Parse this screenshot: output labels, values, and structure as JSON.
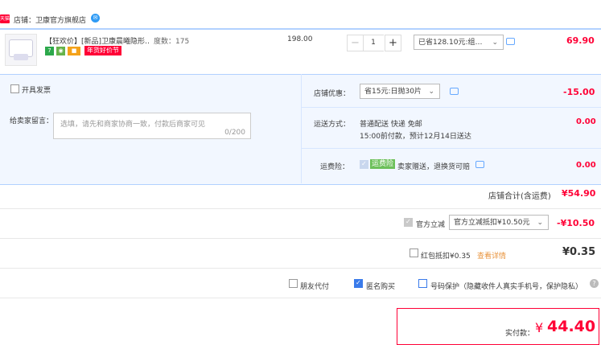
{
  "store": {
    "tmall_badge": "天猫",
    "name": "店铺：卫康官方旗舰店"
  },
  "item": {
    "title": "【狂欢价】[新品]卫康晨曦隐形…",
    "spec": "度数：175",
    "price": "198.00",
    "qty": "1",
    "minus": "−",
    "plus": "+",
    "discount_select": "已省128.10元:组…",
    "subtotal": "69.90",
    "promo_tag": "年货好价节",
    "tag7": "7",
    "tag_gift": "🎁"
  },
  "options": {
    "invoice_label": "开具发票",
    "note_label": "给卖家留言：",
    "note_placeholder": "选填，请先和商家协商一致，付款后商家可见",
    "note_counter": "0/200"
  },
  "store_coupon": {
    "label": "店铺优惠：",
    "select": "省15元:日抛30片",
    "value": "-15.00"
  },
  "shipping": {
    "label": "运送方式：",
    "line1": "普通配送 快递 免邮",
    "line2": "15:00前付款，预计12月14日送达",
    "value": "0.00"
  },
  "insurance": {
    "label": "运费险：",
    "badge": "运费险",
    "text": "卖家赠送，退换货可赔",
    "value": "0.00"
  },
  "store_total": {
    "label": "店铺合计(含运费)",
    "value": "¥54.90"
  },
  "official": {
    "label": "官方立减",
    "select": "官方立减抵扣¥10.50元",
    "value": "-¥10.50"
  },
  "redpacket": {
    "label": "红包抵扣¥0.35",
    "link": "查看详情",
    "value": "¥0.35"
  },
  "bottom": {
    "friend": "朋友代付",
    "anonymous": "匿名购买",
    "privacy": "号码保护（隐藏收件人真实手机号，保护隐私）",
    "help": "?"
  },
  "pay": {
    "label": "实付款：",
    "currency": "¥",
    "amount": "44.40"
  },
  "colors": {
    "accent_red": "#ff0036",
    "link_blue": "#3a7bea",
    "panel_bg": "#f2f7ff"
  }
}
